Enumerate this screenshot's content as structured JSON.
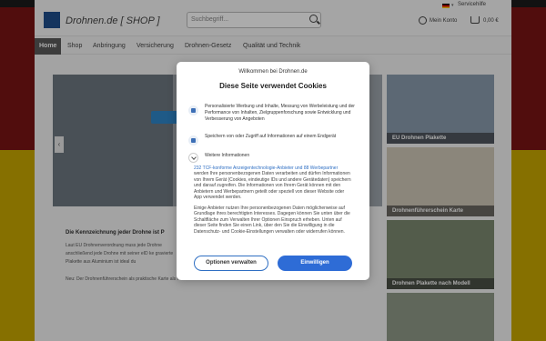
{
  "header": {
    "logo_text": "Drohnen.de [ SHOP ]",
    "search_placeholder": "Suchbegriff...",
    "service_label": "Servicehilfe",
    "account_label": "Mein Konto",
    "cart_label": "0,00 €"
  },
  "nav": {
    "items": [
      "Home",
      "Shop",
      "Anbringung",
      "Versicherung",
      "Drohnen-Gesetz",
      "Qualität und Technik"
    ]
  },
  "main": {
    "heading": "Die Kennzeichnung jeder Drohne ist P",
    "para1": "Laut EU Drohnenverordnung muss jede Drohne anschließend jede Drohne mit seiner eID ke gravierte Plakette aus Aluminium ist ideal du",
    "para2": "Neu: Der Drohnenführerschein als praktische Karte als Pflicht im Scheckkartenformat."
  },
  "sidebar": {
    "cards": [
      "EU Drohnen Plakette",
      "Drohnenführerschein Karte",
      "Drohnen Plakette nach Modell",
      ""
    ]
  },
  "modal": {
    "title": "Willkommen bei Drohnen.de",
    "heading": "Diese Seite verwendet Cookies",
    "purpose1": "Personalisierte Werbung und Inhalte, Messung von Werbeleistung und der Performance von Inhalten, Zielgruppenforschung sowie Entwicklung und Verbesserung von Angeboten",
    "purpose2": "Speichern von oder Zugriff auf Informationen auf einem Endgerät",
    "more_info": "Weitere Informationen",
    "body1_link": "232 TCF-konforme Anzeigentechnologie-Anbieter und 88 Werbepartner",
    "body1_rest": "werden Ihre personenbezogenen Daten verarbeiten und dürfen Informationen von Ihrem Gerät (Cookies, eindeutige IDs und andere Gerätedaten) speichern und darauf zugreifen. Die Informationen von Ihrem Gerät können mit den Anbietern und Werbepartnern geteilt oder speziell von dieser Website oder App verwendet werden.",
    "body2": "Einige Anbieter nutzen Ihre personenbezogenen Daten möglicherweise auf Grundlage ihres berechtigten Interesses. Dagegen können Sie unten über die Schaltfläche zum Verwalten Ihrer Optionen Einspruch erheben. Unten auf dieser Seite finden Sie einen Link, über den Sie die Einwilligung in die Datenschutz- und Cookie-Einstellungen verwalten oder widerrufen können.",
    "manage_label": "Optionen verwalten",
    "accept_label": "Einwilligen"
  }
}
